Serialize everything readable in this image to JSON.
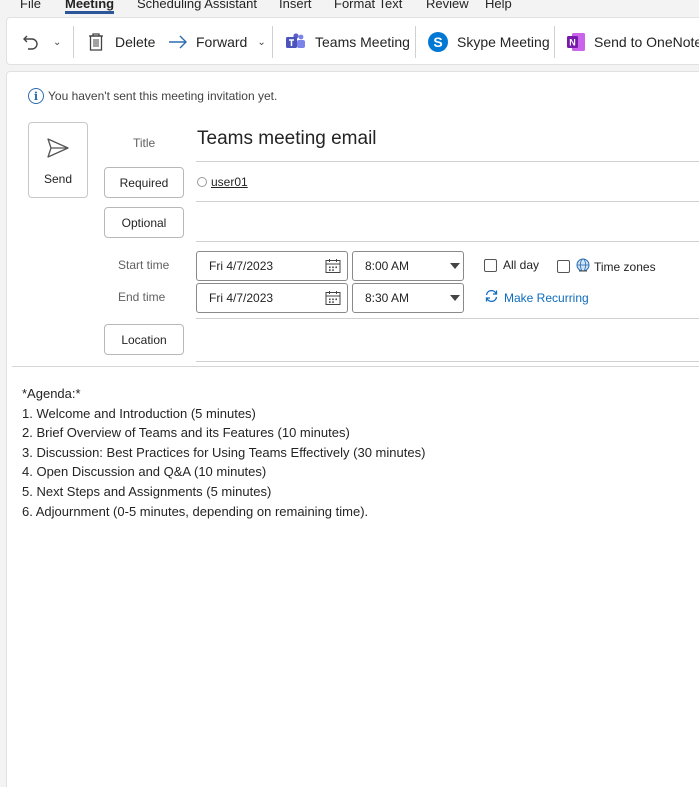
{
  "menu": {
    "tabs": [
      "File",
      "Meeting",
      "Scheduling Assistant",
      "Insert",
      "Format Text",
      "Review",
      "Help"
    ],
    "active": "Meeting"
  },
  "ribbon": {
    "delete_label": "Delete",
    "forward_label": "Forward",
    "teams_label": "Teams Meeting",
    "skype_label": "Skype Meeting",
    "onenote_label": "Send to OneNote"
  },
  "info": {
    "message": "You haven't sent this meeting invitation yet."
  },
  "send": {
    "label": "Send"
  },
  "form": {
    "title_label": "Title",
    "title_value": "Teams meeting email",
    "required_label": "Required",
    "required_recipient": "user01",
    "optional_label": "Optional",
    "start_label": "Start time",
    "end_label": "End time",
    "start_date": "Fri 4/7/2023",
    "start_time": "8:00 AM",
    "end_date": "Fri 4/7/2023",
    "end_time": "8:30 AM",
    "all_day_label": "All day",
    "time_zones_label": "Time zones",
    "make_recurring_label": "Make Recurring",
    "location_label": "Location"
  },
  "body": {
    "lines": [
      "*Agenda:*",
      "1. Welcome and Introduction (5 minutes)",
      "2. Brief Overview of Teams and its Features (10 minutes)",
      "3. Discussion: Best Practices for Using Teams Effectively (30 minutes)",
      "4. Open Discussion and Q&A (10 minutes)",
      "5. Next Steps and Assignments (5 minutes)",
      "6. Adjournment (0-5 minutes, depending on remaining time)."
    ]
  },
  "colors": {
    "accent": "#2b579a",
    "link": "#0f6cbd",
    "teams": "#5b5fc7",
    "skype": "#0078d4",
    "onenote": "#7719aa"
  }
}
